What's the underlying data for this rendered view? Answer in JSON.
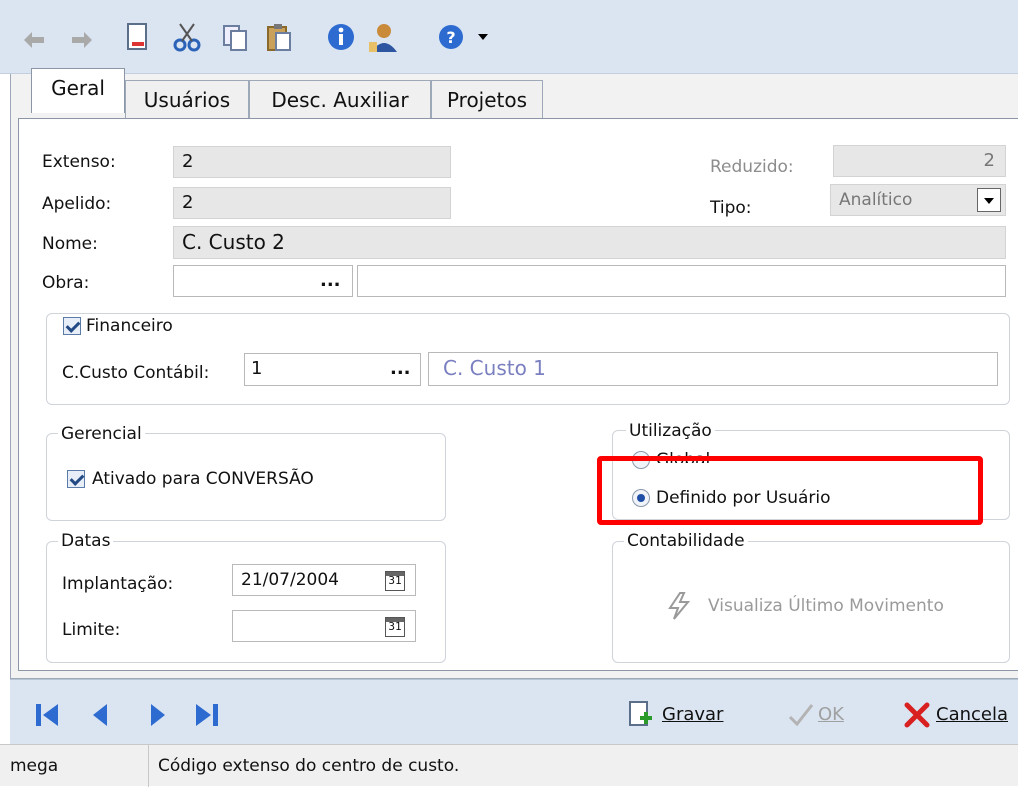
{
  "tabs": [
    "Geral",
    "Usuários",
    "Desc. Auxiliar",
    "Projetos"
  ],
  "fields": {
    "extenso": {
      "label": "Extenso:",
      "value": "2"
    },
    "apelido": {
      "label": "Apelido:",
      "value": "2"
    },
    "nome": {
      "label": "Nome:",
      "value": "C. Custo 2"
    },
    "obra": {
      "label": "Obra:",
      "value": "",
      "lookup": "..."
    },
    "reduzido": {
      "label": "Reduzido:",
      "value": "2"
    },
    "tipo": {
      "label": "Tipo:",
      "value": "Analítico"
    }
  },
  "financeiro": {
    "checkbox_label": "Financeiro",
    "ccusto_label": "C.Custo Contábil:",
    "ccusto_code": "1",
    "ccusto_lookup": "...",
    "ccusto_name": "C. Custo 1"
  },
  "gerencial": {
    "title": "Gerencial",
    "checkbox_label": "Ativado para CONVERSÃO"
  },
  "utilizacao": {
    "title": "Utilização",
    "option_global": "Global",
    "option_user": "Definido por Usuário"
  },
  "datas": {
    "title": "Datas",
    "implantacao_label": "Implantação:",
    "implantacao_value": "21/07/2004",
    "limite_label": "Limite:",
    "limite_value": "",
    "cal_glyph": "31"
  },
  "contabilidade": {
    "title": "Contabilidade",
    "button": "Visualiza Último Movimento"
  },
  "bottom": {
    "save_label": "Gravar",
    "ok_label": "OK",
    "cancel_label": "Cancela"
  },
  "status": {
    "left": "mega",
    "message": "Código extenso do centro de custo."
  },
  "colors": {
    "accent_blue": "#1f5bc4",
    "highlight": "#ff0000",
    "toolbar": "#dbe5f2"
  }
}
